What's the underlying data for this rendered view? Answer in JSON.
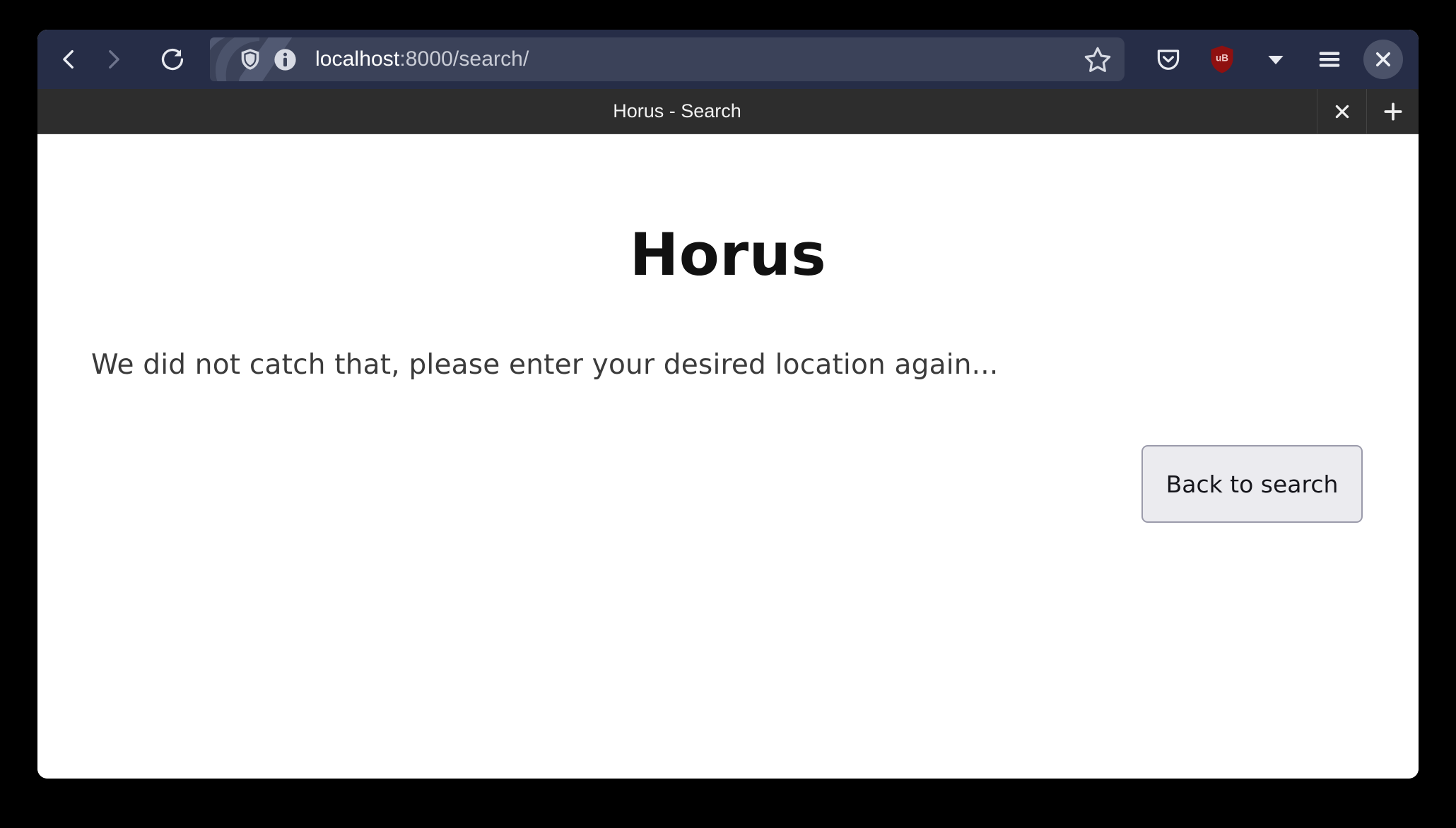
{
  "browser": {
    "nav": {
      "back_label": "Back",
      "forward_label": "Forward",
      "reload_label": "Reload",
      "back_icon": "chevron-left-icon",
      "forward_icon": "chevron-right-icon",
      "reload_icon": "reload-icon"
    },
    "url_bar": {
      "shield_icon": "shield-icon",
      "info_icon": "info-circle-icon",
      "host": "localhost",
      "path": ":8000/search/",
      "full_url": "localhost:8000/search/",
      "bookmark_icon": "star-icon",
      "bookmark_label": "Bookmark this page"
    },
    "toolbar_right": [
      {
        "name": "pocket-icon",
        "label": "Save to Pocket"
      },
      {
        "name": "ublock-origin-icon",
        "label": "uBlock Origin",
        "badge_text": "uB",
        "color": "#9c1111"
      },
      {
        "name": "chevron-down-icon",
        "label": "Overflow menu"
      },
      {
        "name": "hamburger-menu-icon",
        "label": "Open application menu"
      },
      {
        "name": "close-window-icon",
        "label": "Close window"
      }
    ],
    "tabs": {
      "active_title": "Horus - Search",
      "close_tab_label": "×",
      "new_tab_label": "+"
    },
    "colors": {
      "toolbar_bg": "#262d47",
      "urlbar_bg": "#3b4259",
      "tabstrip_bg": "#2d2d2d",
      "page_bg": "#ffffff",
      "ublock_red": "#9c1111",
      "button_bg": "#ebebef",
      "button_border": "#9b9bab"
    }
  },
  "page": {
    "title": "Horus",
    "message": "We did not catch that, please enter your desired location again...",
    "back_button_label": "Back to search"
  }
}
